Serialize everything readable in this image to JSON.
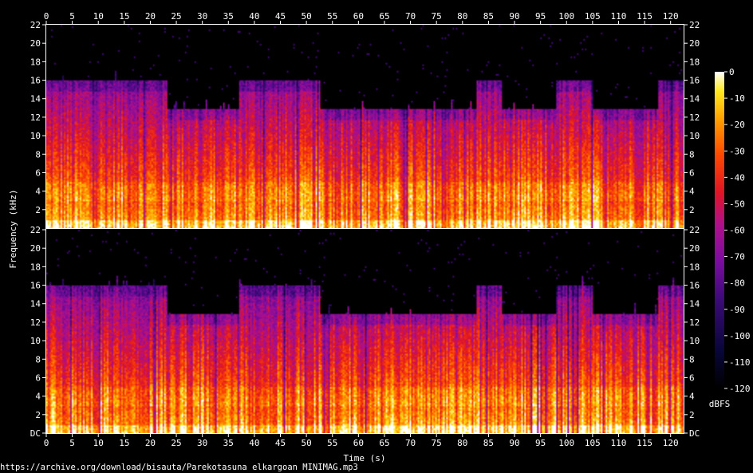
{
  "chart_data": {
    "type": "heatmap",
    "xlabel": "Time (s)",
    "ylabel": "Frequency (kHz)",
    "x_ticks": [
      0,
      5,
      10,
      15,
      20,
      25,
      30,
      35,
      40,
      45,
      50,
      55,
      60,
      65,
      70,
      75,
      80,
      85,
      90,
      95,
      100,
      105,
      110,
      115,
      120
    ],
    "xlim": [
      0,
      122.5
    ],
    "y_ticks": [
      "DC",
      "2",
      "4",
      "6",
      "8",
      "10",
      "12",
      "14",
      "16",
      "18",
      "20",
      "22"
    ],
    "ylim_khz": [
      0,
      22
    ],
    "channels": 2,
    "colorbar": {
      "label": "dBFS",
      "ticks": [
        "0",
        "-10",
        "-20",
        "-30",
        "-40",
        "-50",
        "-60",
        "-70",
        "-80",
        "-90",
        "-100",
        "-110",
        "-120"
      ],
      "range": [
        -120,
        0
      ]
    },
    "lowpass_segments_khz": [
      {
        "t0": 0,
        "t1": 23,
        "cutoff": 16
      },
      {
        "t0": 23,
        "t1": 37,
        "cutoff": 13
      },
      {
        "t0": 37,
        "t1": 52.5,
        "cutoff": 16
      },
      {
        "t0": 52.5,
        "t1": 82.5,
        "cutoff": 13
      },
      {
        "t0": 82.5,
        "t1": 87.5,
        "cutoff": 16
      },
      {
        "t0": 87.5,
        "t1": 98,
        "cutoff": 13
      },
      {
        "t0": 98,
        "t1": 105,
        "cutoff": 16
      },
      {
        "t0": 105,
        "t1": 117.5,
        "cutoff": 13
      },
      {
        "t0": 117.5,
        "t1": 122.5,
        "cutoff": 16
      }
    ],
    "colors": {
      "high": "#ffffa0",
      "mid": "#e01020",
      "low": "#5a0a90",
      "floor": "#000000"
    }
  },
  "footer": {
    "source_url": "https://archive.org/download/bisauta/Parekotasuna elkargoan MINIMAG.mp3"
  }
}
